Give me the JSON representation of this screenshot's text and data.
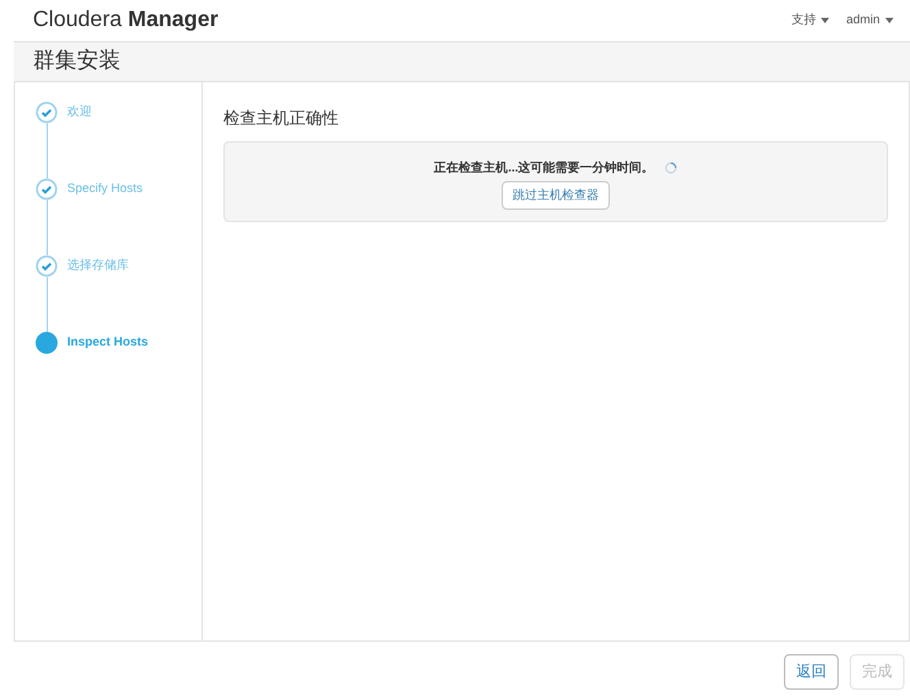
{
  "header": {
    "brand_light": "Cloudera",
    "brand_bold": "Manager",
    "menus": [
      {
        "label": "支持"
      },
      {
        "label": "admin"
      }
    ]
  },
  "page_title": "群集安装",
  "steps": [
    {
      "label": "欢迎",
      "kind": "done"
    },
    {
      "label": "Specify Hosts",
      "kind": "done"
    },
    {
      "label": "选择存储库",
      "kind": "done"
    },
    {
      "label": "Inspect Hosts",
      "kind": "current"
    }
  ],
  "section_title": "检查主机正确性",
  "status_message": "正在检查主机...这可能需要一分钟时间。",
  "skip_button": "跳过主机检查器",
  "footer_buttons": [
    {
      "label": "返回",
      "disabled": false
    },
    {
      "label": "完成",
      "disabled": true
    }
  ]
}
